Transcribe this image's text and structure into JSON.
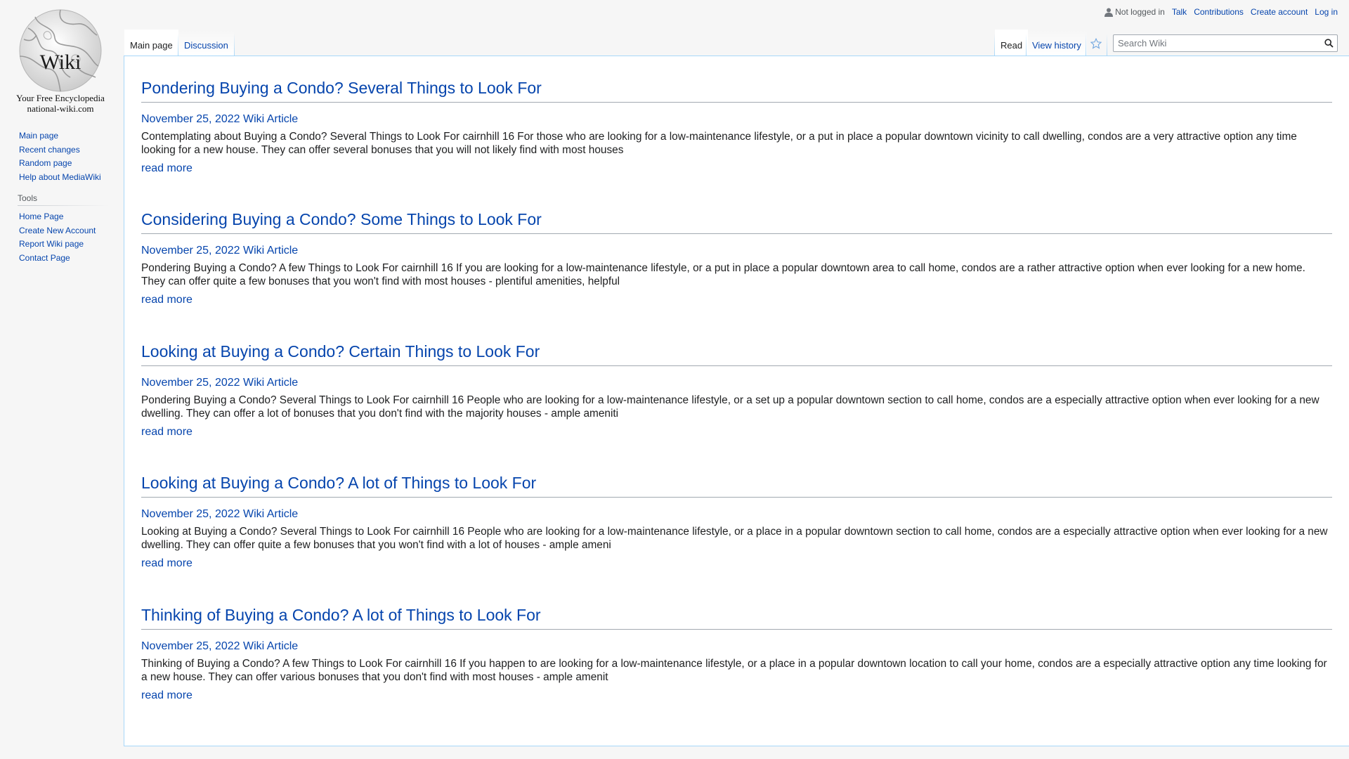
{
  "logo": {
    "word": "Wiki",
    "tagline": "Your Free Encyclopedia",
    "domain": "national-wiki.com"
  },
  "personal": {
    "anon": "Not logged in",
    "talk": "Talk",
    "contributions": "Contributions",
    "create_account": "Create account",
    "login": "Log in"
  },
  "tabs": {
    "main": "Main page",
    "discussion": "Discussion",
    "read": "Read",
    "history": "View history"
  },
  "search": {
    "placeholder": "Search Wiki"
  },
  "sidebar": {
    "nav": [
      "Main page",
      "Recent changes",
      "Random page",
      "Help about MediaWiki"
    ],
    "tools_heading": "Tools",
    "tools": [
      "Home Page",
      "Create New Account",
      "Report Wiki page",
      "Contact Page"
    ]
  },
  "articles": [
    {
      "title": "Pondering Buying a Condo? Several Things to Look For",
      "meta": "November 25, 2022 Wiki Article",
      "body": "Contemplating about Buying a Condo? Several Things to Look For cairnhill 16 For those who are looking for a low-maintenance lifestyle, or a put in place a popular downtown vicinity to call dwelling, condos are a very attractive option any time looking for a new house. They can offer several bonuses that you will not likely find with most houses",
      "more": "read more"
    },
    {
      "title": "Considering Buying a Condo? Some Things to Look For",
      "meta": "November 25, 2022 Wiki Article",
      "body": "Pondering Buying a Condo? A few Things to Look For cairnhill 16 If you are looking for a low-maintenance lifestyle, or a put in place a popular downtown area to call home, condos are a rather attractive option when ever looking for a new home. They can offer quite a few bonuses that you won't find with most houses - plentiful amenities, helpful",
      "more": "read more"
    },
    {
      "title": "Looking at Buying a Condo? Certain Things to Look For",
      "meta": "November 25, 2022 Wiki Article",
      "body": "Pondering Buying a Condo? Several Things to Look For cairnhill 16 People who are looking for a low-maintenance lifestyle, or a set up a popular downtown section to call home, condos are a especially attractive option when ever looking for a new dwelling. They can offer a lot of bonuses that you don't find with the majority houses - ample ameniti",
      "more": "read more"
    },
    {
      "title": "Looking at Buying a Condo? A lot of Things to Look For",
      "meta": "November 25, 2022 Wiki Article",
      "body": "Looking at Buying a Condo? Several Things to Look For cairnhill 16 People who are looking for a low-maintenance lifestyle, or a place in a popular downtown section to call home, condos are a especially attractive option when ever looking for a new dwelling. They can offer quite a few bonuses that you won't find with a lot of houses - ample ameni",
      "more": "read more"
    },
    {
      "title": "Thinking of Buying a Condo? A lot of Things to Look For",
      "meta": "November 25, 2022 Wiki Article",
      "body": "Thinking of Buying a Condo? A few Things to Look For cairnhill 16 If you happen to are looking for a low-maintenance lifestyle, or a place in a popular downtown location to call your home, condos are a especially attractive option any time looking for a new house. They can offer various bonuses that you don't find with most houses - ample amenit",
      "more": "read more"
    }
  ]
}
